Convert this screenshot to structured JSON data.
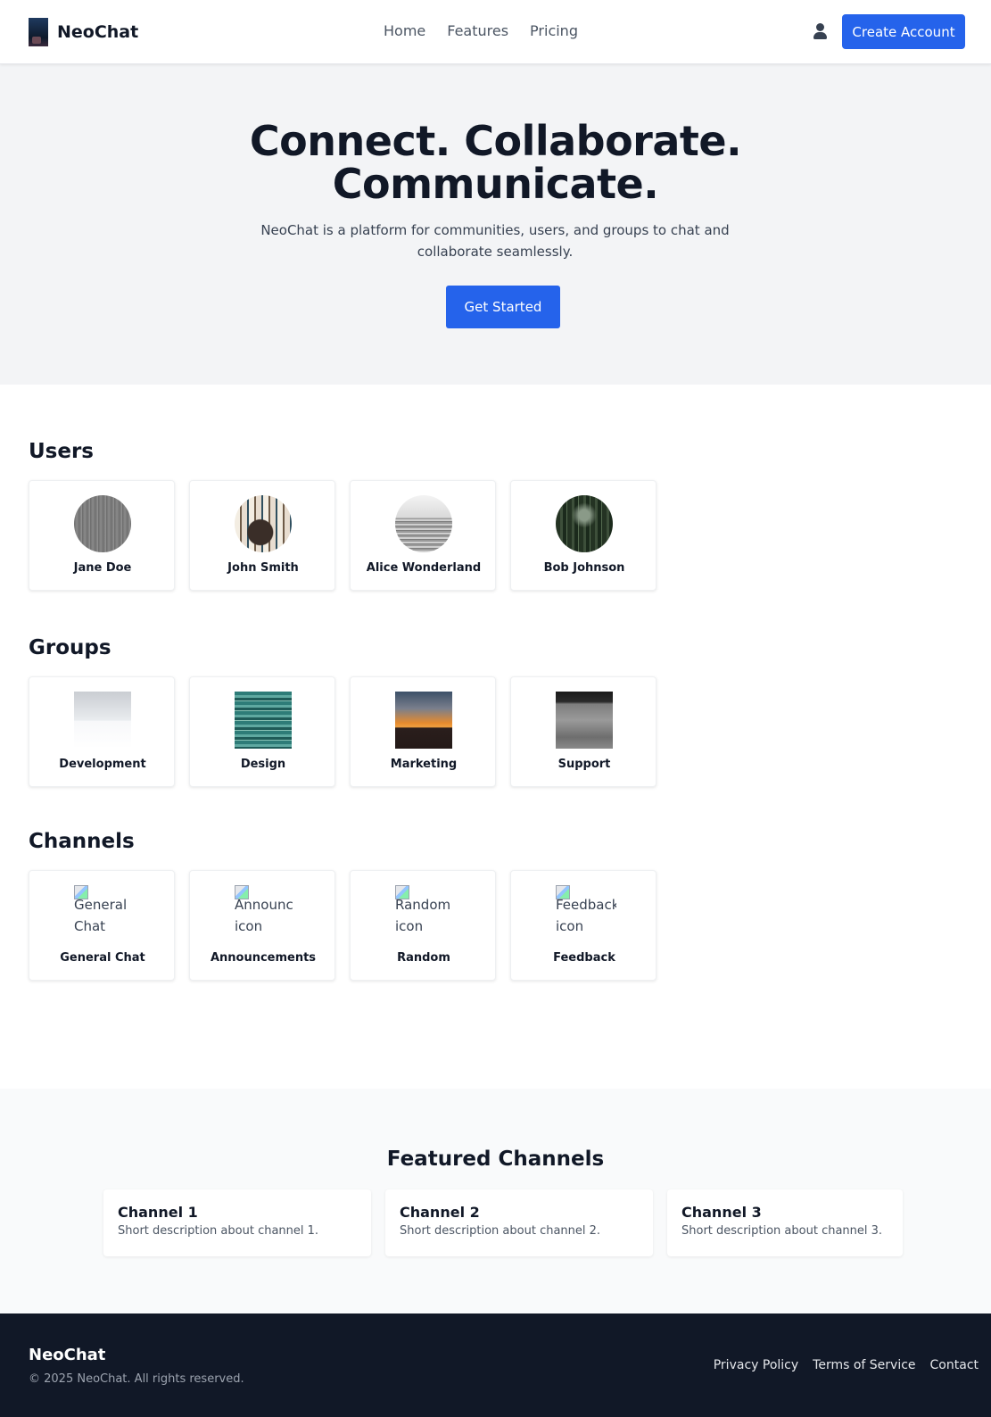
{
  "header": {
    "brand": "NeoChat",
    "nav": [
      "Home",
      "Features",
      "Pricing"
    ],
    "create_account": "Create Account"
  },
  "hero": {
    "title_line1": "Connect. Collaborate.",
    "title_line2": "Communicate.",
    "subtitle": "NeoChat is a platform for communities, users, and groups to chat and collaborate seamlessly.",
    "cta": "Get Started"
  },
  "users": {
    "title": "Users",
    "items": [
      "Jane Doe",
      "John Smith",
      "Alice Wonderland",
      "Bob Johnson"
    ]
  },
  "groups": {
    "title": "Groups",
    "items": [
      "Development",
      "Design",
      "Marketing",
      "Support"
    ]
  },
  "channels": {
    "title": "Channels",
    "items": [
      {
        "label": "General Chat",
        "alt": "General Chat"
      },
      {
        "label": "Announcements",
        "alt": "Announc icon"
      },
      {
        "label": "Random",
        "alt": "Random icon"
      },
      {
        "label": "Feedback",
        "alt": "Feedback icon"
      }
    ]
  },
  "featured": {
    "title": "Featured Channels",
    "items": [
      {
        "name": "Channel 1",
        "desc": "Short description about channel 1."
      },
      {
        "name": "Channel 2",
        "desc": "Short description about channel 2."
      },
      {
        "name": "Channel 3",
        "desc": "Short description about channel 3."
      }
    ]
  },
  "footer": {
    "brand": "NeoChat",
    "copyright": "© 2025 NeoChat. All rights reserved.",
    "links": [
      "Privacy Policy",
      "Terms of Service",
      "Contact"
    ]
  },
  "colors": {
    "primary": "#2563eb",
    "dark": "#111827",
    "hero_bg": "#f3f4f6"
  }
}
